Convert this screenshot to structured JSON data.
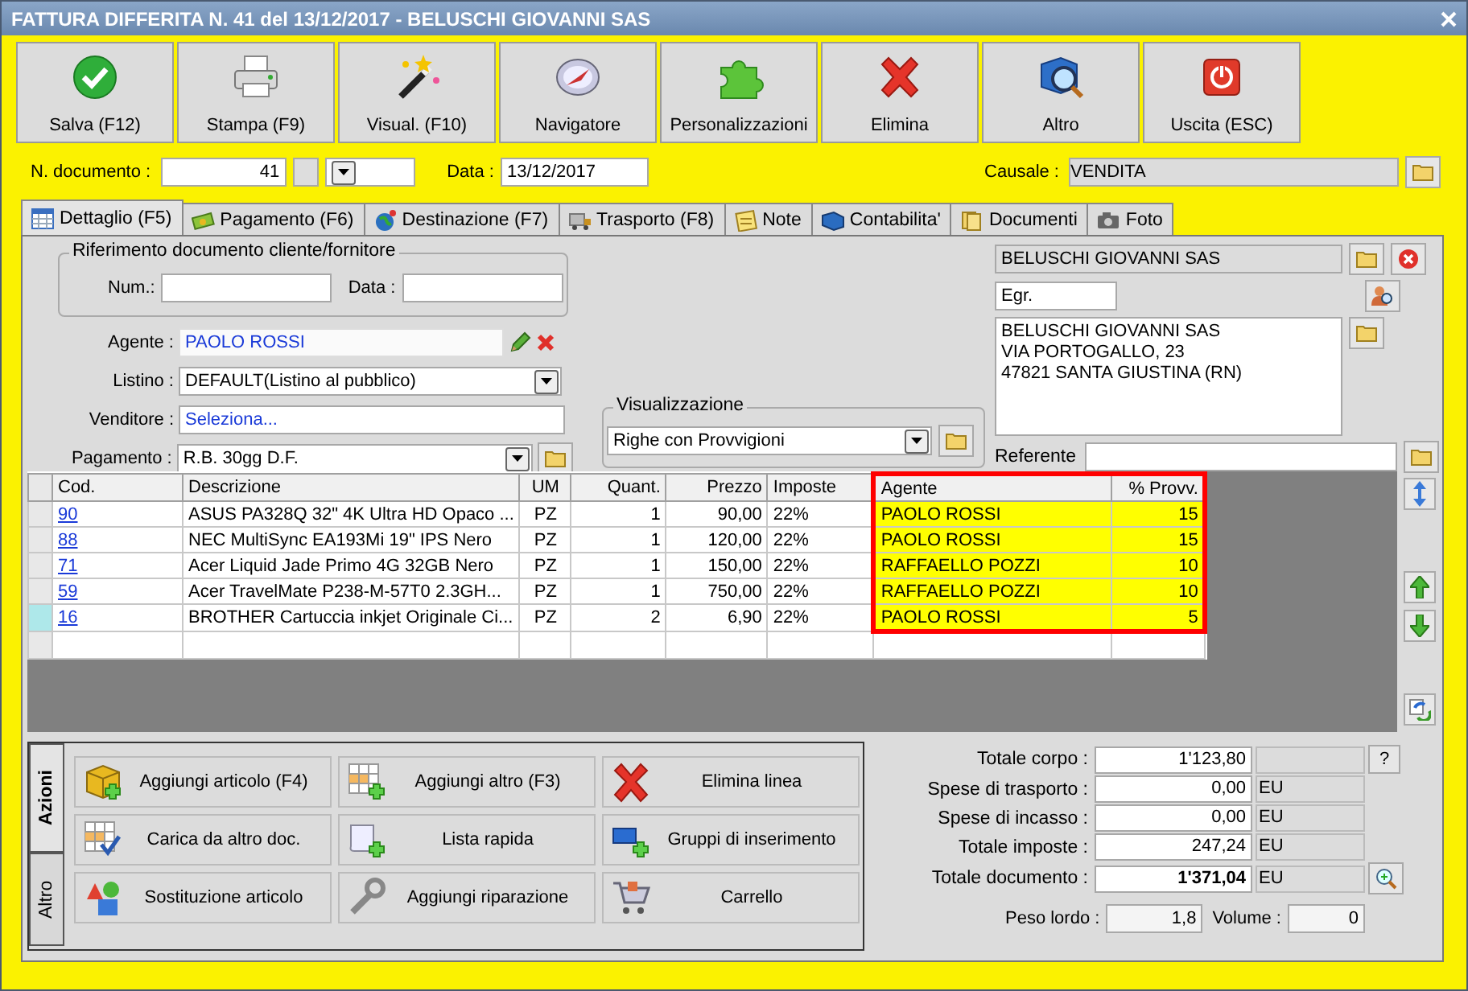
{
  "window": {
    "title": "FATTURA DIFFERITA N. 41 del 13/12/2017 - BELUSCHI GIOVANNI SAS"
  },
  "toolbar": [
    {
      "label": "Salva (F12)"
    },
    {
      "label": "Stampa (F9)"
    },
    {
      "label": "Visual. (F10)"
    },
    {
      "label": "Navigatore"
    },
    {
      "label": "Personalizzazioni"
    },
    {
      "label": "Elimina"
    },
    {
      "label": "Altro"
    },
    {
      "label": "Uscita (ESC)"
    }
  ],
  "header": {
    "doc_number": {
      "label": "N. documento :",
      "value": "41"
    },
    "date": {
      "label": "Data :",
      "value": "13/12/2017"
    },
    "causale": {
      "label": "Causale :",
      "value": "VENDITA"
    }
  },
  "tabs": [
    {
      "label": "Dettaglio (F5)",
      "selected": true
    },
    {
      "label": "Pagamento (F6)",
      "selected": false
    },
    {
      "label": "Destinazione (F7)",
      "selected": false
    },
    {
      "label": "Trasporto (F8)",
      "selected": false
    },
    {
      "label": "Note",
      "selected": false
    },
    {
      "label": "Contabilita'",
      "selected": false
    },
    {
      "label": "Documenti",
      "selected": false
    },
    {
      "label": "Foto",
      "selected": false
    }
  ],
  "riferimento": {
    "title": "Riferimento documento cliente/fornitore",
    "num_label": "Num.:",
    "data_label": "Data :"
  },
  "fields": [
    {
      "label": "Agente :",
      "value": "PAOLO ROSSI",
      "kind": "agent"
    },
    {
      "label": "Listino :",
      "value": "DEFAULT(Listino al pubblico)",
      "kind": "select"
    },
    {
      "label": "Venditore :",
      "value": "Seleziona...",
      "kind": "link"
    },
    {
      "label": "Pagamento :",
      "value": "R.B. 30gg D.F.",
      "kind": "select-folder"
    }
  ],
  "visualizzazione": {
    "title": "Visualizzazione",
    "value": "Righe con Provvigioni"
  },
  "customer": {
    "name": "BELUSCHI GIOVANNI SAS",
    "salutation": "Egr.",
    "address": [
      "BELUSCHI GIOVANNI SAS",
      "VIA PORTOGALLO, 23",
      "47821 SANTA GIUSTINA (RN)"
    ],
    "referente_label": "Referente"
  },
  "table": {
    "columns": [
      {
        "label": "Cod.",
        "highlighted": false
      },
      {
        "label": "Descrizione",
        "highlighted": false
      },
      {
        "label": "UM",
        "highlighted": false
      },
      {
        "label": "Quant.",
        "highlighted": false
      },
      {
        "label": "Prezzo",
        "highlighted": false
      },
      {
        "label": "Imposte",
        "highlighted": false
      },
      {
        "label": "Agente",
        "highlighted": true
      },
      {
        "label": "% Provv.",
        "highlighted": true
      }
    ],
    "rows": [
      {
        "selected": false,
        "cells": [
          "90",
          "ASUS PA328Q 32\" 4K Ultra HD Opaco ...",
          "PZ",
          "1",
          "90,00",
          "22%",
          "PAOLO ROSSI",
          "15"
        ]
      },
      {
        "selected": false,
        "cells": [
          "88",
          "NEC MultiSync EA193Mi 19\" IPS Nero",
          "PZ",
          "1",
          "120,00",
          "22%",
          "PAOLO ROSSI",
          "15"
        ]
      },
      {
        "selected": false,
        "cells": [
          "71",
          "Acer Liquid Jade Primo 4G 32GB Nero",
          "PZ",
          "1",
          "150,00",
          "22%",
          "RAFFAELLO POZZI",
          "10"
        ]
      },
      {
        "selected": false,
        "cells": [
          "59",
          "Acer TravelMate P238-M-57T0 2.3GH...",
          "PZ",
          "1",
          "750,00",
          "22%",
          "RAFFAELLO POZZI",
          "10"
        ]
      },
      {
        "selected": true,
        "cells": [
          "16",
          "BROTHER Cartuccia inkjet Originale Ci...",
          "PZ",
          "2",
          "6,90",
          "22%",
          "PAOLO ROSSI",
          "5"
        ]
      }
    ]
  },
  "action_tabs": [
    {
      "label": "Azioni",
      "selected": true
    },
    {
      "label": "Altro",
      "selected": false
    }
  ],
  "actions": [
    {
      "label": "Aggiungi articolo (F4)"
    },
    {
      "label": "Aggiungi altro (F3)"
    },
    {
      "label": "Elimina linea"
    },
    {
      "label": "Carica da altro doc."
    },
    {
      "label": "Lista rapida"
    },
    {
      "label": "Gruppi di inserimento"
    },
    {
      "label": "Sostituzione articolo"
    },
    {
      "label": "Aggiungi riparazione"
    },
    {
      "label": "Carrello"
    }
  ],
  "totals": [
    {
      "label": "Totale corpo :",
      "value": "1'123,80",
      "bold": false,
      "kind": "help",
      "help": "?"
    },
    {
      "label": "Spese di trasporto :",
      "value": "0,00",
      "unit": "EU",
      "bold": false,
      "kind": "plain"
    },
    {
      "label": "Spese di incasso :",
      "value": "0,00",
      "unit": "EU",
      "bold": false,
      "kind": "plain"
    },
    {
      "label": "Totale imposte :",
      "value": "247,24",
      "unit": "EU",
      "bold": false,
      "kind": "plain"
    },
    {
      "label": "Totale documento :",
      "value": "1'371,04",
      "unit": "EU",
      "bold": true,
      "kind": "zoom"
    }
  ],
  "weights": [
    {
      "label": "Peso lordo :",
      "value": "1,8"
    },
    {
      "label": "Volume :",
      "value": "0"
    }
  ]
}
